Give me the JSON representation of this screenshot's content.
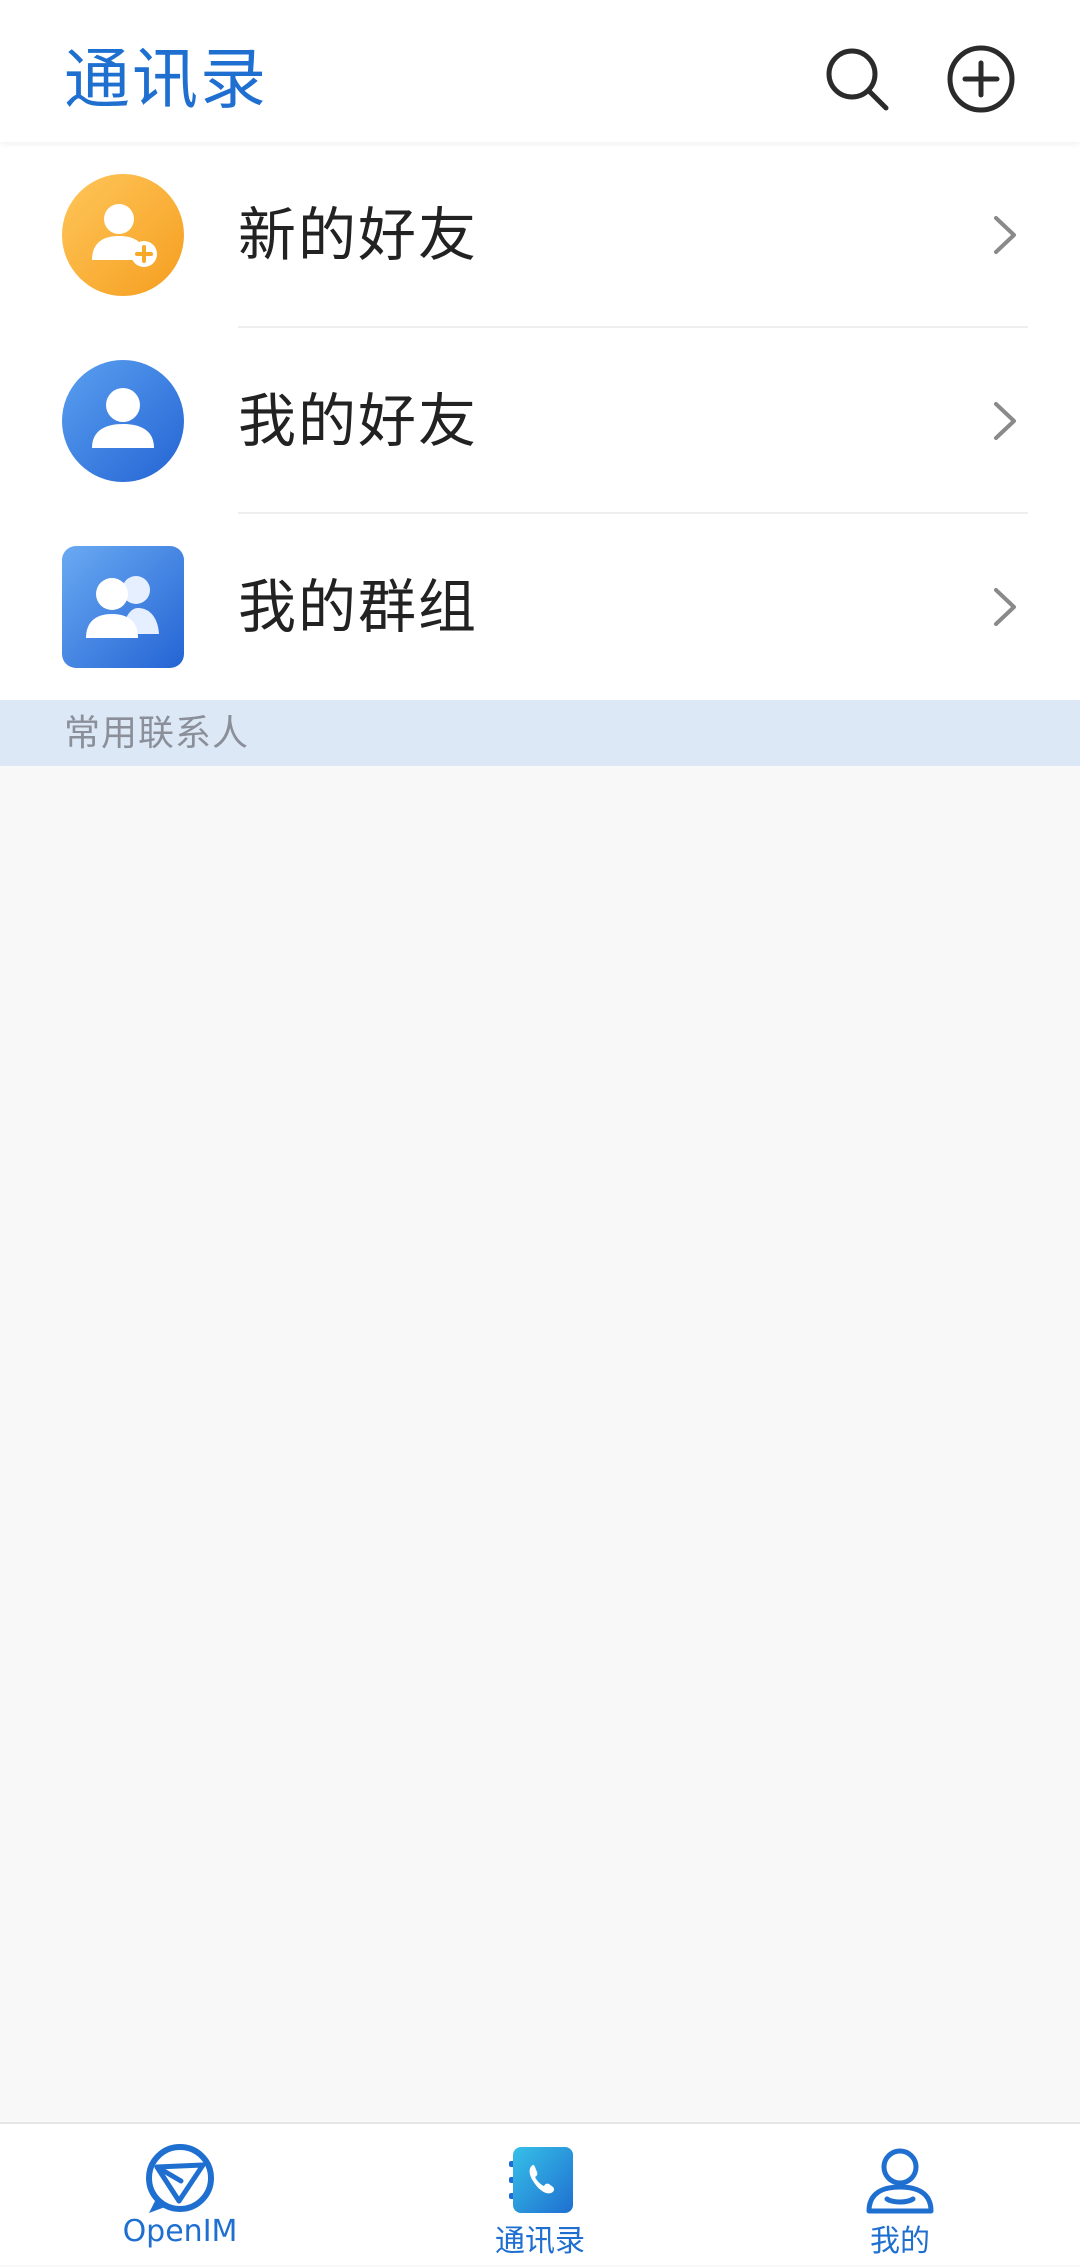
{
  "header": {
    "title": "通讯录",
    "search_icon": "search-icon",
    "add_icon": "plus-circle-icon",
    "title_color": "#1f6fd0"
  },
  "menu": {
    "items": [
      {
        "label": "新的好友",
        "icon": "add-user-icon",
        "color": "#f7a928"
      },
      {
        "label": "我的好友",
        "icon": "user-icon",
        "color": "#2f78e0"
      },
      {
        "label": "我的群组",
        "icon": "group-icon",
        "color": "#2f78e0"
      }
    ]
  },
  "section": {
    "title": "常用联系人",
    "background": "#dde8f6"
  },
  "bottom_nav": {
    "items": [
      {
        "label": "OpenIM",
        "icon": "openim-logo-icon"
      },
      {
        "label": "通讯录",
        "icon": "contacts-phone-icon"
      },
      {
        "label": "我的",
        "icon": "profile-icon"
      }
    ],
    "active_color": "#1f6fd0"
  }
}
